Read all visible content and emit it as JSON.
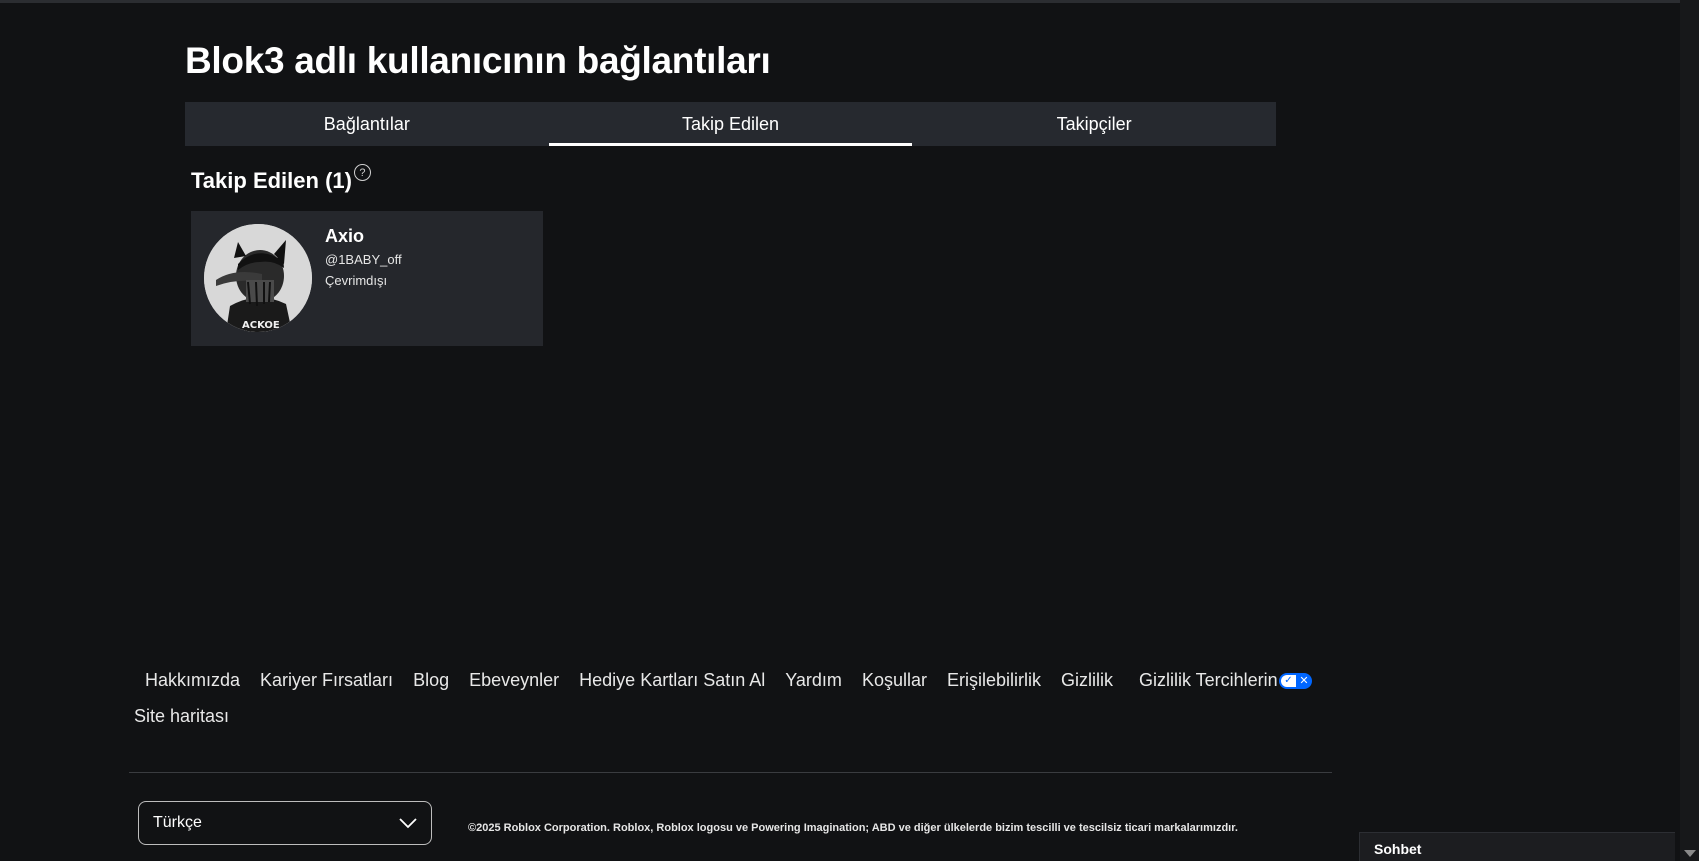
{
  "page": {
    "title": "Blok3 adlı kullanıcının bağlantıları"
  },
  "tabs": [
    {
      "label": "Bağlantılar",
      "active": false
    },
    {
      "label": "Takip Edilen",
      "active": true
    },
    {
      "label": "Takipçiler",
      "active": false
    }
  ],
  "section": {
    "title": "Takip Edilen (1)",
    "help_icon": "?"
  },
  "users": [
    {
      "display_name": "Axio",
      "handle": "@1BABY_off",
      "status": "Çevrimdışı"
    }
  ],
  "footer": {
    "links": [
      "Hakkımızda",
      "Kariyer Fırsatları",
      "Blog",
      "Ebeveynler",
      "Hediye Kartları Satın Al",
      "Yardım",
      "Koşullar",
      "Erişilebilirlik",
      "Gizlilik",
      "Gizlilik Tercihlerin"
    ],
    "sitemap": "Site haritası",
    "language": "Türkçe",
    "copyright": "©2025 Roblox Corporation. Roblox, Roblox logosu ve Powering Imagination; ABD ve diğer ülkelerde bizim tescilli ve tescilsiz ticari markalarımızdır."
  },
  "chat": {
    "label": "Sohbet"
  },
  "colors": {
    "background": "#111214",
    "surface": "#26292f",
    "accent": "#0066ff"
  }
}
